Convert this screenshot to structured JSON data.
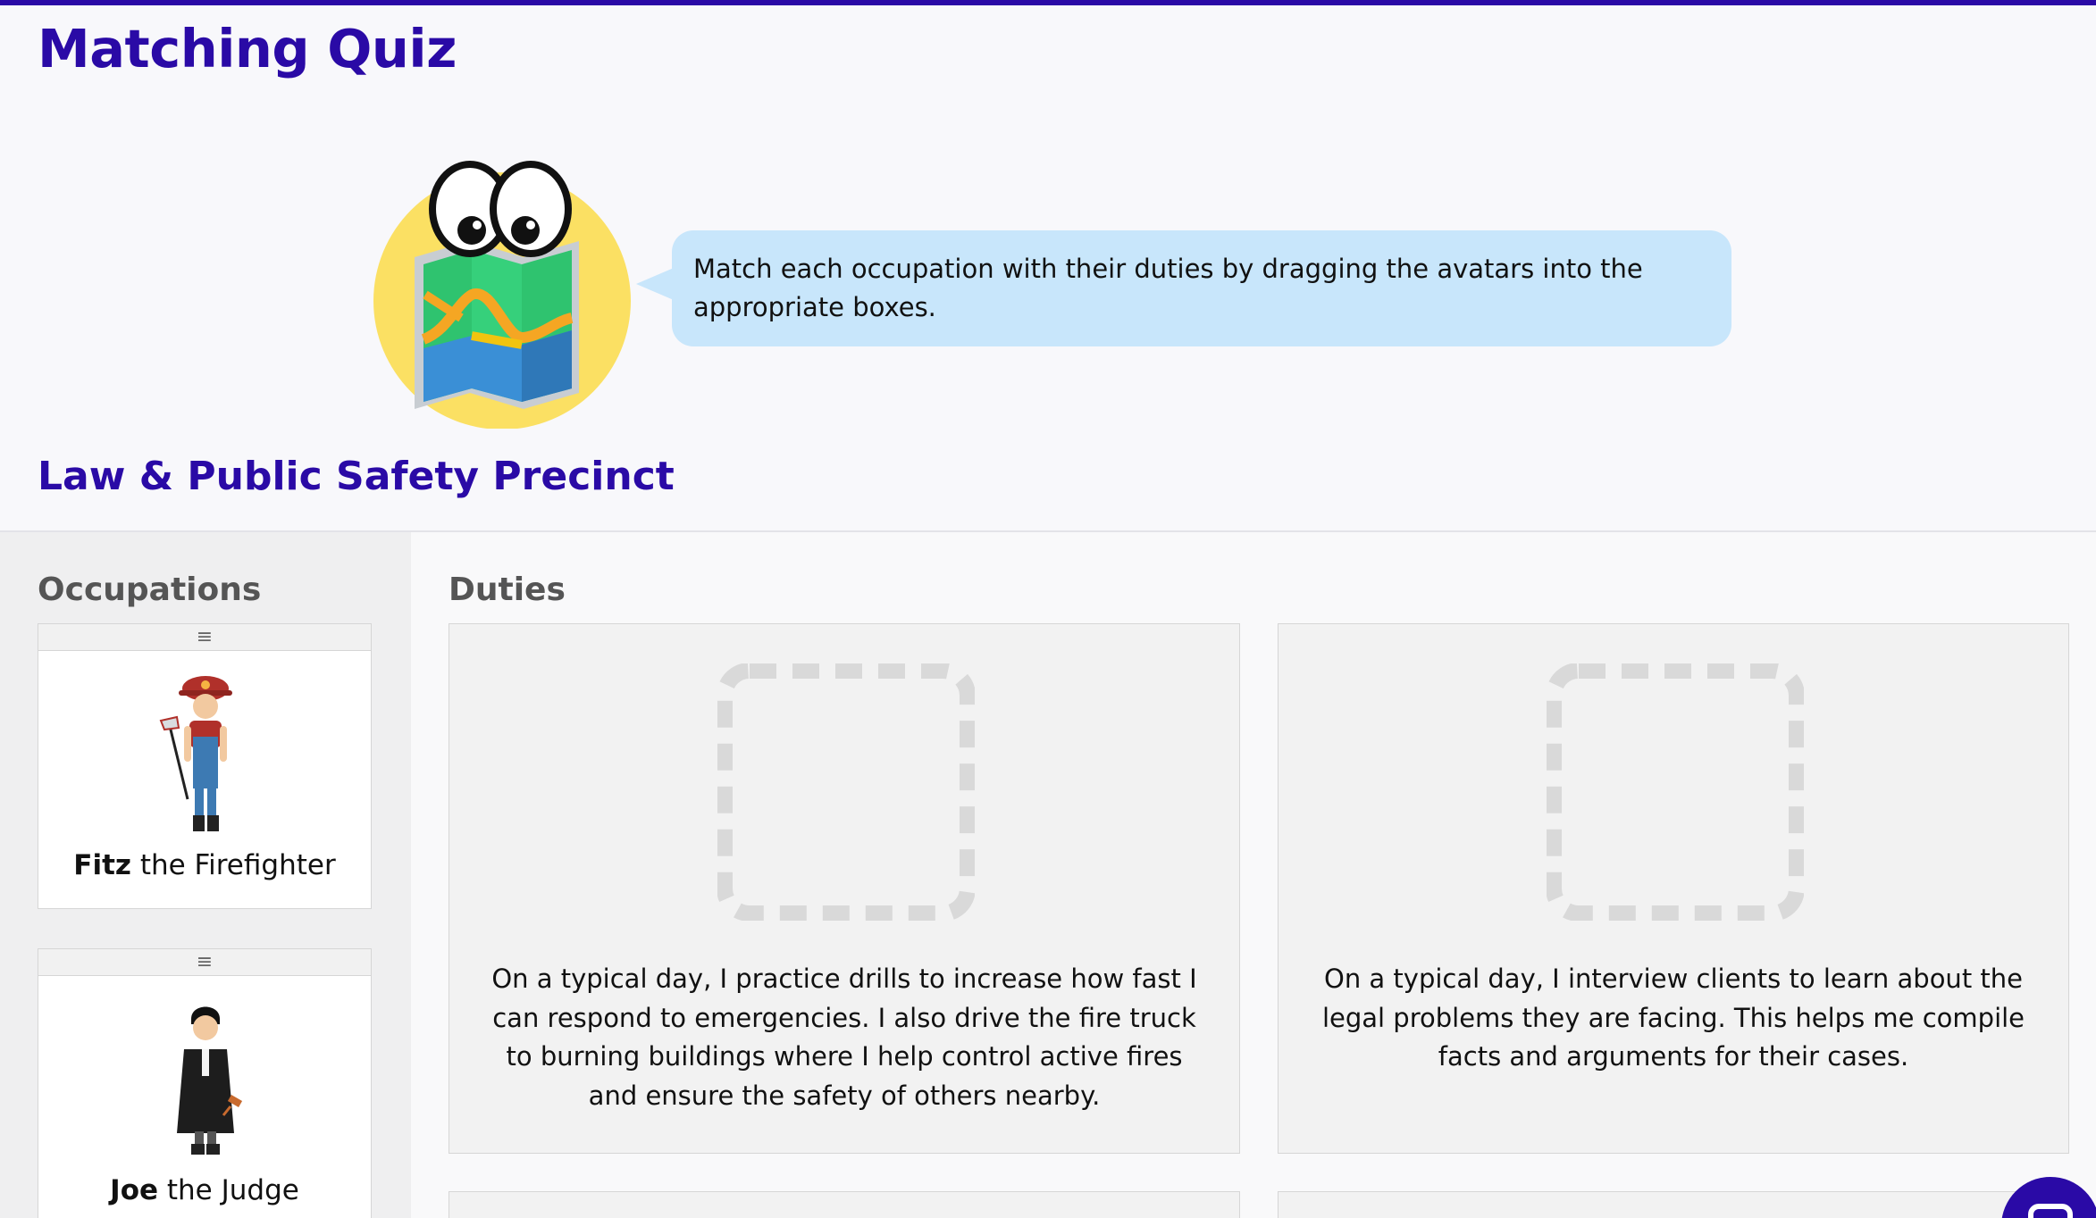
{
  "page": {
    "title": "Matching Quiz",
    "instructions": "Match each occupation with their duties by dragging the avatars into the appropriate boxes.",
    "precinct_title": "Law & Public Safety Precinct"
  },
  "occupations": {
    "heading": "Occupations",
    "handle_glyph": "≡",
    "items": [
      {
        "name": "Fitz",
        "role": " the Firefighter"
      },
      {
        "name": "Joe",
        "role": " the Judge"
      }
    ]
  },
  "duties": {
    "heading": "Duties",
    "items": [
      {
        "text": "On a typical day, I practice drills to increase how fast I can respond to emergencies. I also drive the fire truck to burning buildings where I help control active fires and ensure the safety of others nearby."
      },
      {
        "text": "On a typical day, I interview clients to learn about the legal problems they are facing. This helps me compile facts and arguments for their cases."
      }
    ]
  },
  "colors": {
    "brand": "#2a0aa6",
    "bubble": "#c8e6fb",
    "drop_zone": "#d9d9d9"
  },
  "icons": {
    "mascot": "map-mascot-icon",
    "handle": "drag-handle-icon",
    "chat": "chat-icon"
  }
}
